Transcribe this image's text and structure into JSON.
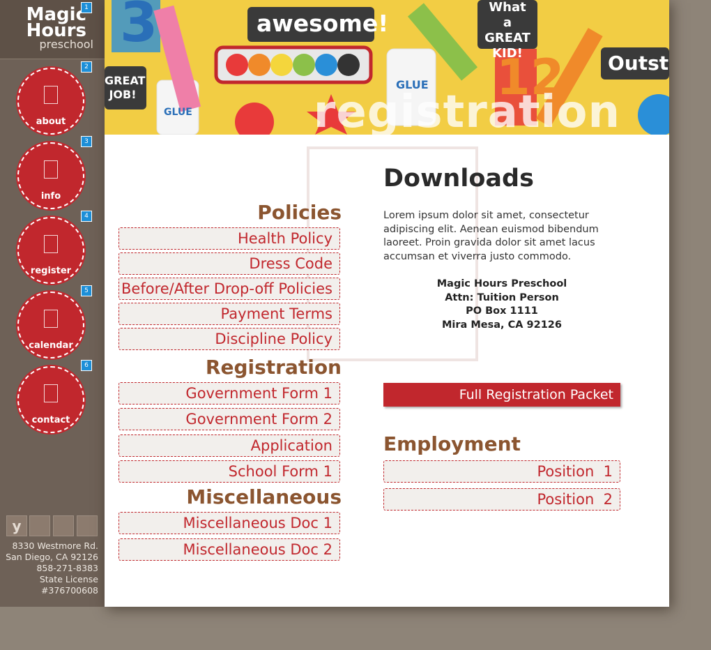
{
  "brand": {
    "line1": "Magic",
    "line2": "Hours",
    "line3": "preschool"
  },
  "nav": [
    {
      "num": "1"
    },
    {
      "num": "2",
      "label": "about"
    },
    {
      "num": "3",
      "label": "info"
    },
    {
      "num": "4",
      "label": "register"
    },
    {
      "num": "5",
      "label": "calendar"
    },
    {
      "num": "6",
      "label": "contact"
    }
  ],
  "social": [
    {
      "glyph": "y"
    },
    {
      "glyph": ""
    },
    {
      "glyph": ""
    },
    {
      "glyph": ""
    }
  ],
  "address": [
    "8330 Westmore Rd.",
    "San Diego, CA 92126",
    "858-271-8383",
    "State License",
    "#376700608"
  ],
  "banner": {
    "title": "registration",
    "stickers": [
      "awesome!",
      "What a GREAT KID!",
      "GREAT JOB!",
      "GLUE",
      "GLUE",
      "Outst",
      "3",
      "12"
    ]
  },
  "sections": {
    "policies": {
      "title": "Policies",
      "items": [
        "Health Policy",
        "Dress Code",
        "Before/After Drop-off Policies",
        "Payment Terms",
        "Discipline Policy"
      ]
    },
    "registration": {
      "title": "Registration",
      "items": [
        "Government Form 1",
        "Government Form 2",
        "Application",
        "School Form 1"
      ]
    },
    "misc": {
      "title": "Miscellaneous",
      "items": [
        "Miscellaneous Doc 1",
        "Miscellaneous Doc 2"
      ]
    }
  },
  "downloads": {
    "title": "Downloads",
    "body": "Lorem ipsum dolor sit amet, consectetur adipiscing elit. Aenean euismod bibendum laoreet. Proin gravida dolor sit amet lacus accumsan et viverra justo commodo.",
    "postal": [
      "Magic Hours Preschool",
      "Attn: Tuition Person",
      "PO Box 1111",
      "Mira Mesa, CA 92126"
    ],
    "packet_button": "Full Registration Packet"
  },
  "employment": {
    "title": "Employment",
    "items": [
      "Position  1",
      "Position  2"
    ]
  },
  "colors": {
    "accent": "#c1272d",
    "brown": "#8b5530",
    "sidebar": "#6e6157",
    "background": "#8e8478"
  }
}
